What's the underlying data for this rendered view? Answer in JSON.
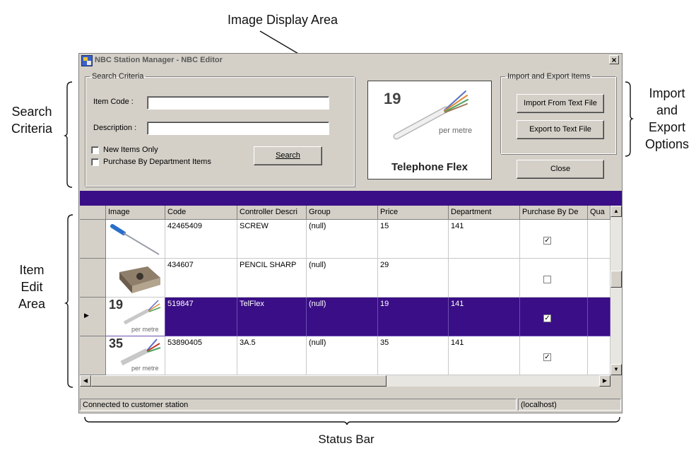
{
  "annotations": {
    "image_display_area": "Image Display Area",
    "search_criteria": [
      "Search",
      "Criteria"
    ],
    "import_export_options": [
      "Import",
      "and",
      "Export",
      "Options"
    ],
    "item_edit_area": [
      "Item",
      "Edit",
      "Area"
    ],
    "status_bar": "Status Bar"
  },
  "window": {
    "title": "NBC Station Manager - NBC Editor",
    "close_glyph": "×"
  },
  "search": {
    "legend": "Search Criteria",
    "item_code_label": "Item Code :",
    "item_code_value": "",
    "description_label": "Description :",
    "description_value": "",
    "new_items_only_label": "New Items Only",
    "new_items_only_checked": false,
    "purchase_by_department_label": "Purchase By Department Items",
    "purchase_by_department_checked": false,
    "search_button": "Search"
  },
  "image_display": {
    "price": "19",
    "unit": "per metre",
    "name": "Telephone Flex"
  },
  "import_export": {
    "legend": "Import and Export Items",
    "import_button": "Import From Text File",
    "export_button": "Export to Text File"
  },
  "close_button": "Close",
  "grid": {
    "columns": [
      "Image",
      "Code",
      "Controller Descri",
      "Group",
      "Price",
      "Department",
      "Purchase By De",
      "Qua"
    ],
    "rows": [
      {
        "image": "screwdriver",
        "code": "42465409",
        "description": "SCREW",
        "group": "(null)",
        "price": "15",
        "department": "141",
        "purchase_by_dept": true,
        "selected": false
      },
      {
        "image": "pencil-sharpener",
        "code": "434607",
        "description": "PENCIL SHARP",
        "group": "(null)",
        "price": "29",
        "department": "",
        "purchase_by_dept": false,
        "selected": false
      },
      {
        "image": "telephone-flex",
        "img_price": "19",
        "img_unit": "per metre",
        "code": "519847",
        "description": "TelFlex",
        "group": "(null)",
        "price": "19",
        "department": "141",
        "purchase_by_dept": true,
        "selected": true
      },
      {
        "image": "cable",
        "img_price": "35",
        "img_unit": "per metre",
        "code": "53890405",
        "description": "3A.5",
        "group": "(null)",
        "price": "35",
        "department": "141",
        "purchase_by_dept": true,
        "selected": false
      }
    ]
  },
  "status": {
    "message": "Connected to customer station",
    "host": "(localhost)"
  },
  "colors": {
    "selection": "#3a0e86",
    "window_bg": "#d4d0c8"
  }
}
